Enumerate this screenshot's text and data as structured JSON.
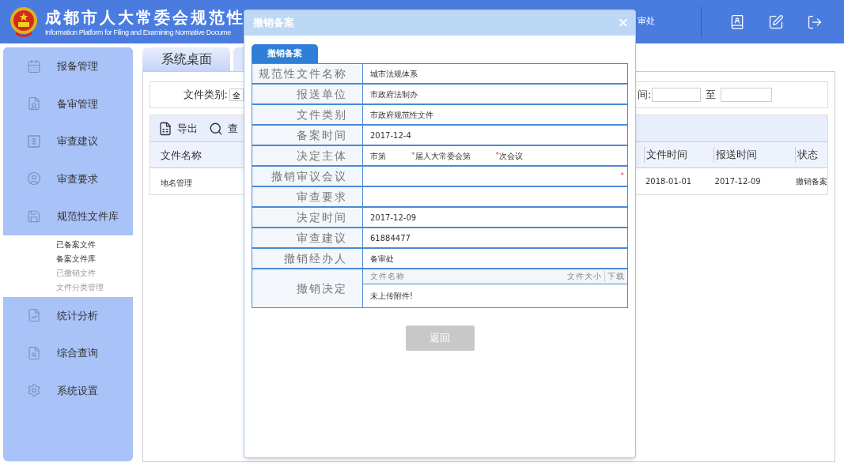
{
  "header": {
    "title": "成都市人大常委会规范性",
    "subtitle": "Information Platform for Filing and Examining Normative Docume",
    "user_fragment": "审处"
  },
  "sidebar": {
    "items": [
      {
        "label": "报备管理"
      },
      {
        "label": "备审管理"
      },
      {
        "label": "审查建议"
      },
      {
        "label": "审查要求"
      },
      {
        "label": "规范性文件库",
        "children": [
          {
            "label": "已备案文件",
            "emphasized": true
          },
          {
            "label": "备案文件库",
            "emphasized": true
          },
          {
            "label": "已撤销文件",
            "emphasized": false
          },
          {
            "label": "文件分类管理",
            "emphasized": false
          }
        ]
      },
      {
        "label": "统计分析"
      },
      {
        "label": "综合查询"
      },
      {
        "label": "系统设置"
      }
    ]
  },
  "tabs": [
    {
      "label": "系统桌面",
      "selected": true
    },
    {
      "selected": false
    }
  ],
  "filter": {
    "category_label": "文件类别:",
    "category_value": "全",
    "time_label": "间:",
    "range_separator": "至"
  },
  "toolbar": [
    {
      "label": "导出"
    },
    {
      "label": "查"
    }
  ],
  "table": {
    "left_columns": [
      "文件名称"
    ],
    "right_columns": [
      "文件时间",
      "报送时间",
      "状态"
    ],
    "rows": [
      {
        "left": [
          "地名管理"
        ],
        "right": [
          "2018-01-01",
          "2017-12-09",
          "撤销备案"
        ]
      }
    ]
  },
  "modal": {
    "title": "撤销备案",
    "close": "✕",
    "tab": "撤销备案",
    "fields": [
      {
        "kind": "text",
        "label": "规范性文件名称",
        "value": "城市法规体系"
      },
      {
        "kind": "text",
        "label": "报送单位",
        "value": "市政府法制办"
      },
      {
        "kind": "text",
        "label": "文件类别",
        "value": "市政府规范性文件"
      },
      {
        "kind": "text",
        "label": "备案时间",
        "value": "2017-12-4"
      },
      {
        "kind": "segments",
        "label": "决定主体",
        "segments": [
          {
            "text": "市第"
          },
          {
            "mark": "*",
            "text": "届人大常委会第"
          },
          {
            "mark": "*",
            "text": "次会议"
          }
        ]
      },
      {
        "kind": "text",
        "label": "撤销审议会议",
        "mark": "*"
      },
      {
        "kind": "text",
        "label": "审查要求"
      },
      {
        "kind": "text",
        "label": "决定时间",
        "value": "2017-12-09"
      },
      {
        "kind": "text",
        "label": "审查建议",
        "value": "61884477"
      },
      {
        "kind": "text",
        "label": "撤销经办人",
        "value": "备审处"
      },
      {
        "kind": "attachments",
        "label": "撤销决定",
        "columns": [
          "文件名称",
          "文件大小",
          "下载"
        ],
        "empty": "未上传附件!"
      }
    ],
    "button": {
      "label": "返回",
      "disabled": true
    }
  }
}
